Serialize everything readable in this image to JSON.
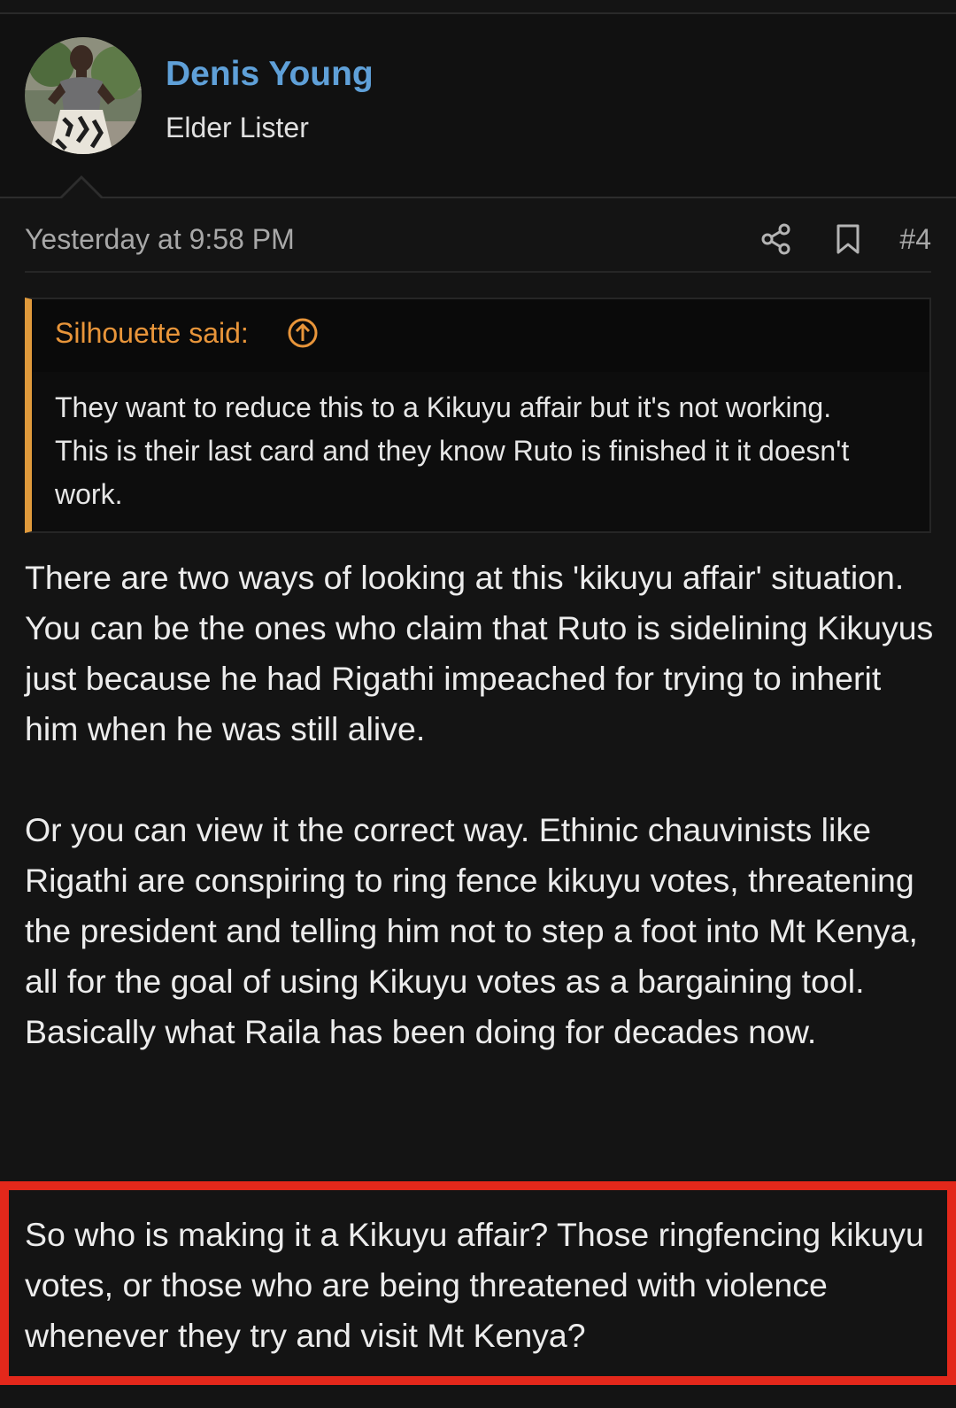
{
  "user": {
    "name": "Denis Young",
    "title": "Elder Lister"
  },
  "post": {
    "timestamp": "Yesterday at 9:58 PM",
    "number": "#4",
    "icons": [
      "share-icon",
      "bookmark-icon"
    ]
  },
  "quote": {
    "author": "Silhouette said:",
    "text": "They want to reduce this to a Kikuyu affair but it's not working. This is their last card and they know Ruto is finished it it doesn't work."
  },
  "body": {
    "paragraph1": "There are two ways of looking at this 'kikuyu affair' situation. You can be the ones who claim that Ruto is sidelining Kikuyus just because he had Rigathi impeached for trying to inherit him when he was still alive.",
    "paragraph2": "Or you can view it the correct way. Ethinic chauvinists like Rigathi are conspiring to ring fence kikuyu votes, threatening the president and telling him not to step a foot into Mt Kenya, all for the goal of using Kikuyu votes as a bargaining tool. Basically what Raila has been doing for decades now.",
    "paragraph3": "So who is making it a Kikuyu affair? Those ringfencing kikuyu votes, or those who are being threatened with violence whenever they try and visit Mt Kenya?"
  },
  "colors": {
    "username": "#5fa0d8",
    "quote_accent": "#e09a3c",
    "highlight_border": "#e3281b",
    "background": "#141414"
  }
}
